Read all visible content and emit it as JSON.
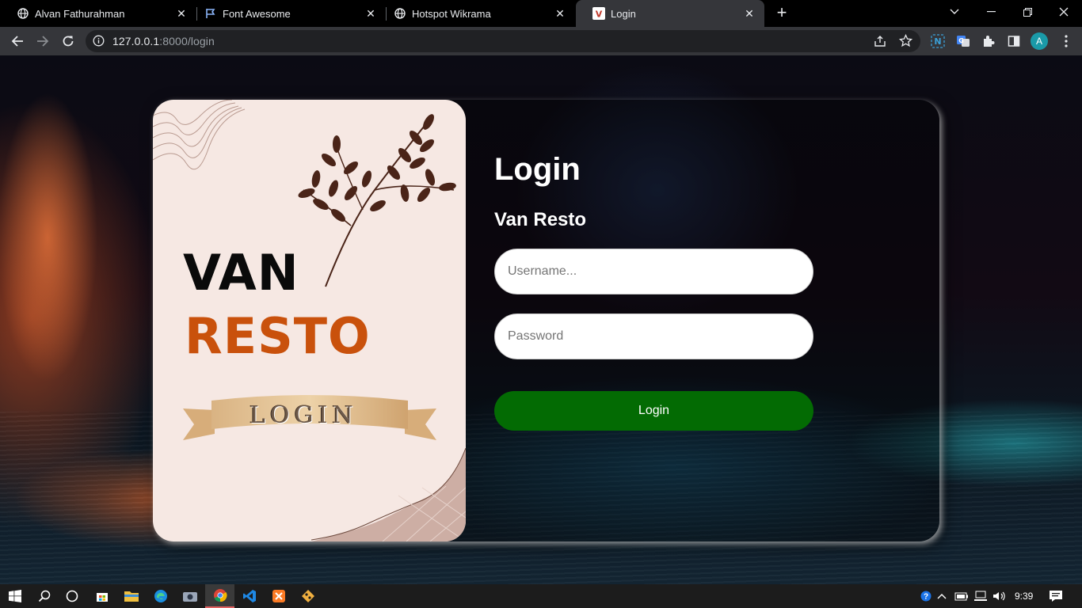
{
  "browser": {
    "tabs": [
      {
        "title": "Alvan Fathurahman",
        "icon": "globe-icon"
      },
      {
        "title": "Font Awesome",
        "icon": "flag-icon"
      },
      {
        "title": "Hotspot Wikrama",
        "icon": "globe-icon"
      },
      {
        "title": "Login",
        "icon": "v-favicon",
        "active": true
      }
    ],
    "url_host": "127.0.0.1",
    "url_path": ":8000/login",
    "profile_initial": "A",
    "profile_color": "#1a9aa8"
  },
  "brand": {
    "line1": "VAN",
    "line2": "RESTO",
    "ribbon": "LOGIN",
    "line2_color": "#c9510c"
  },
  "form": {
    "title": "Login",
    "subtitle": "Van Resto",
    "username_placeholder": "Username...",
    "password_placeholder": "Password",
    "submit_label": "Login",
    "submit_color": "#036b03"
  },
  "taskbar": {
    "clock": "9:39",
    "apps": [
      "start-icon",
      "search-icon",
      "task-view-icon",
      "store-icon",
      "file-explorer-icon",
      "edge-icon",
      "camera-icon",
      "chrome-icon",
      "vscode-icon",
      "xampp-icon",
      "git-icon"
    ]
  }
}
